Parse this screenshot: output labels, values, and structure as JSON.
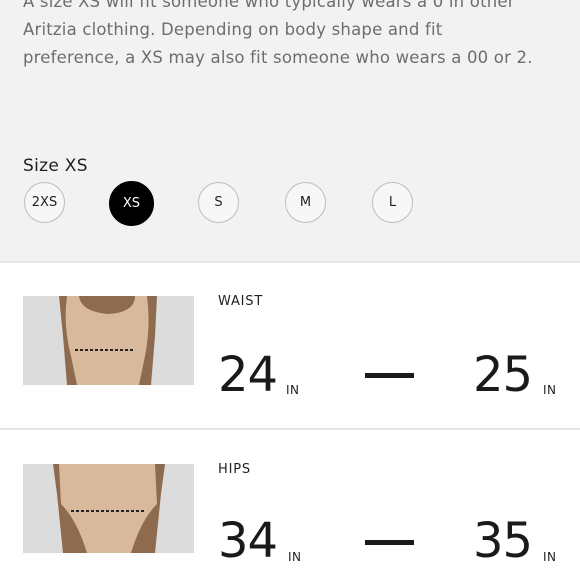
{
  "description": {
    "lines": [
      "A size XS will fit someone who typically wears a 0 in other",
      "Aritzia clothing. Depending on body shape and fit",
      "preference, a XS may also fit someone who wears a 00 or 2."
    ]
  },
  "size_selector": {
    "heading": "Size XS",
    "options": [
      "2XS",
      "XS",
      "S",
      "M",
      "L"
    ],
    "selected": "XS"
  },
  "measurements": [
    {
      "label": "WAIST",
      "min": "24",
      "max": "25",
      "unit": "IN"
    },
    {
      "label": "HIPS",
      "min": "34",
      "max": "35",
      "unit": "IN"
    }
  ]
}
